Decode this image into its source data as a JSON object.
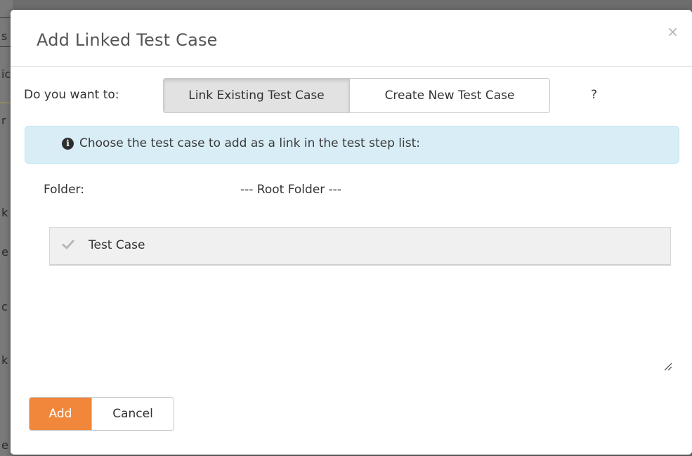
{
  "background": {
    "fragments": [
      "s",
      "ic",
      "r",
      "k",
      "e",
      "c",
      "k",
      "e"
    ]
  },
  "dialog": {
    "title": "Add Linked Test Case",
    "close_glyph": "×"
  },
  "mode_selector": {
    "label": "Do you want to:",
    "options": [
      "Link Existing Test Case",
      "Create New Test Case"
    ],
    "selected": "Link Existing Test Case",
    "help": "?"
  },
  "info": {
    "icon": "info-circle-icon",
    "message": "Choose the test case to add as a link in the test step list:"
  },
  "folder": {
    "label": "Folder:",
    "value": "--- Root Folder ---"
  },
  "test_cases": [
    {
      "label": "Test Case",
      "icon": "check-icon"
    }
  ],
  "footer": {
    "add_label": "Add",
    "cancel_label": "Cancel"
  },
  "colors": {
    "accent": "#f0873a",
    "info_bg": "#d9edf7",
    "info_border": "#bce8f1",
    "overlay": "#6d6d6d"
  }
}
